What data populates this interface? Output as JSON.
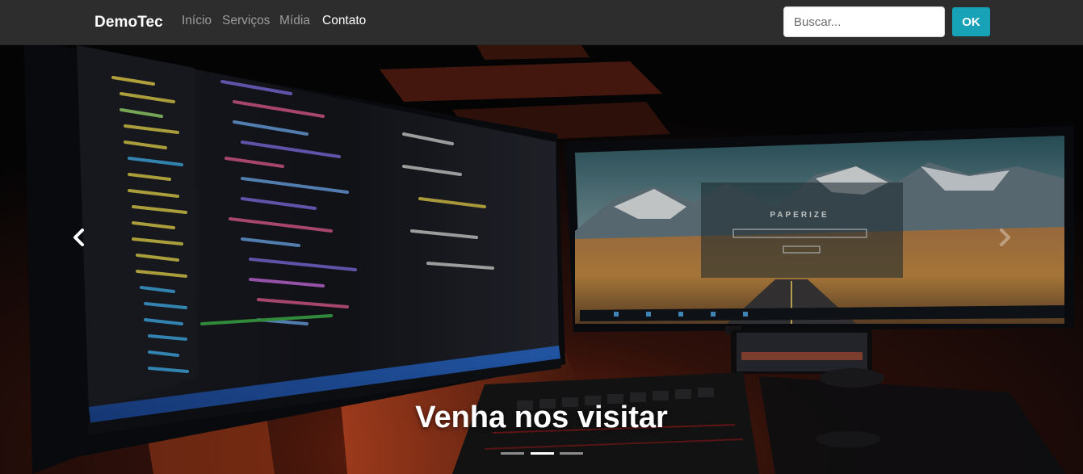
{
  "navbar": {
    "brand": "DemoTec",
    "links": [
      {
        "label": "Início",
        "active": false
      },
      {
        "label": "Serviços",
        "active": false
      },
      {
        "label": "Mídia",
        "active": false
      },
      {
        "label": "Contato",
        "active": true
      }
    ],
    "search": {
      "placeholder": "Buscar...",
      "value": ""
    },
    "search_button": "OK"
  },
  "carousel": {
    "caption": "Venha nos visitar",
    "slide_count": 3,
    "active_slide": 2,
    "prev_icon": "chevron-left-icon",
    "next_icon": "chevron-right-icon",
    "image_subject": "two-monitor-desk-setup-code-editor-and-mountain-wallpaper",
    "screen_text": "PAPERIZE"
  },
  "colors": {
    "navbar_bg": "#2e2d2d",
    "button_accent": "#17a2b8",
    "link_muted": "#9d9c9c",
    "link_active": "#ffffff"
  }
}
